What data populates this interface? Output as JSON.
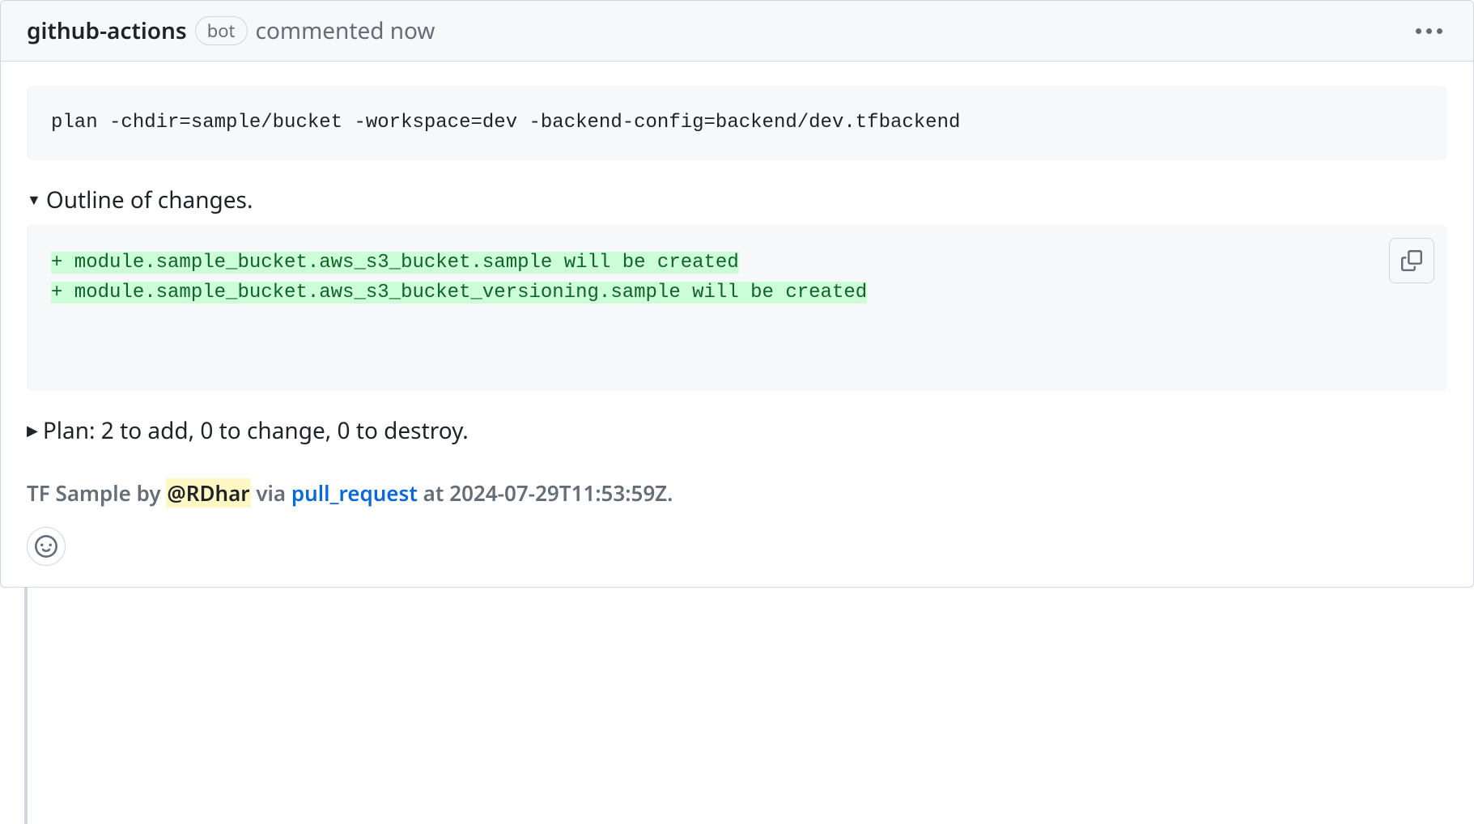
{
  "header": {
    "author": "github-actions",
    "bot_label": "bot",
    "commented_text": "commented now"
  },
  "body": {
    "command": "plan -chdir=sample/bucket -workspace=dev -backend-config=backend/dev.tfbackend",
    "outline": {
      "title": "Outline of changes.",
      "diff_lines": [
        "+ module.sample_bucket.aws_s3_bucket.sample will be created",
        "+ module.sample_bucket.aws_s3_bucket_versioning.sample will be created"
      ]
    },
    "plan_summary": "Plan: 2 to add, 0 to change, 0 to destroy.",
    "footer": {
      "prefix": "TF Sample by ",
      "mention": "@RDhar",
      "via": " via ",
      "link_text": "pull_request",
      "at_text": " at 2024-07-29T11:53:59Z."
    }
  }
}
